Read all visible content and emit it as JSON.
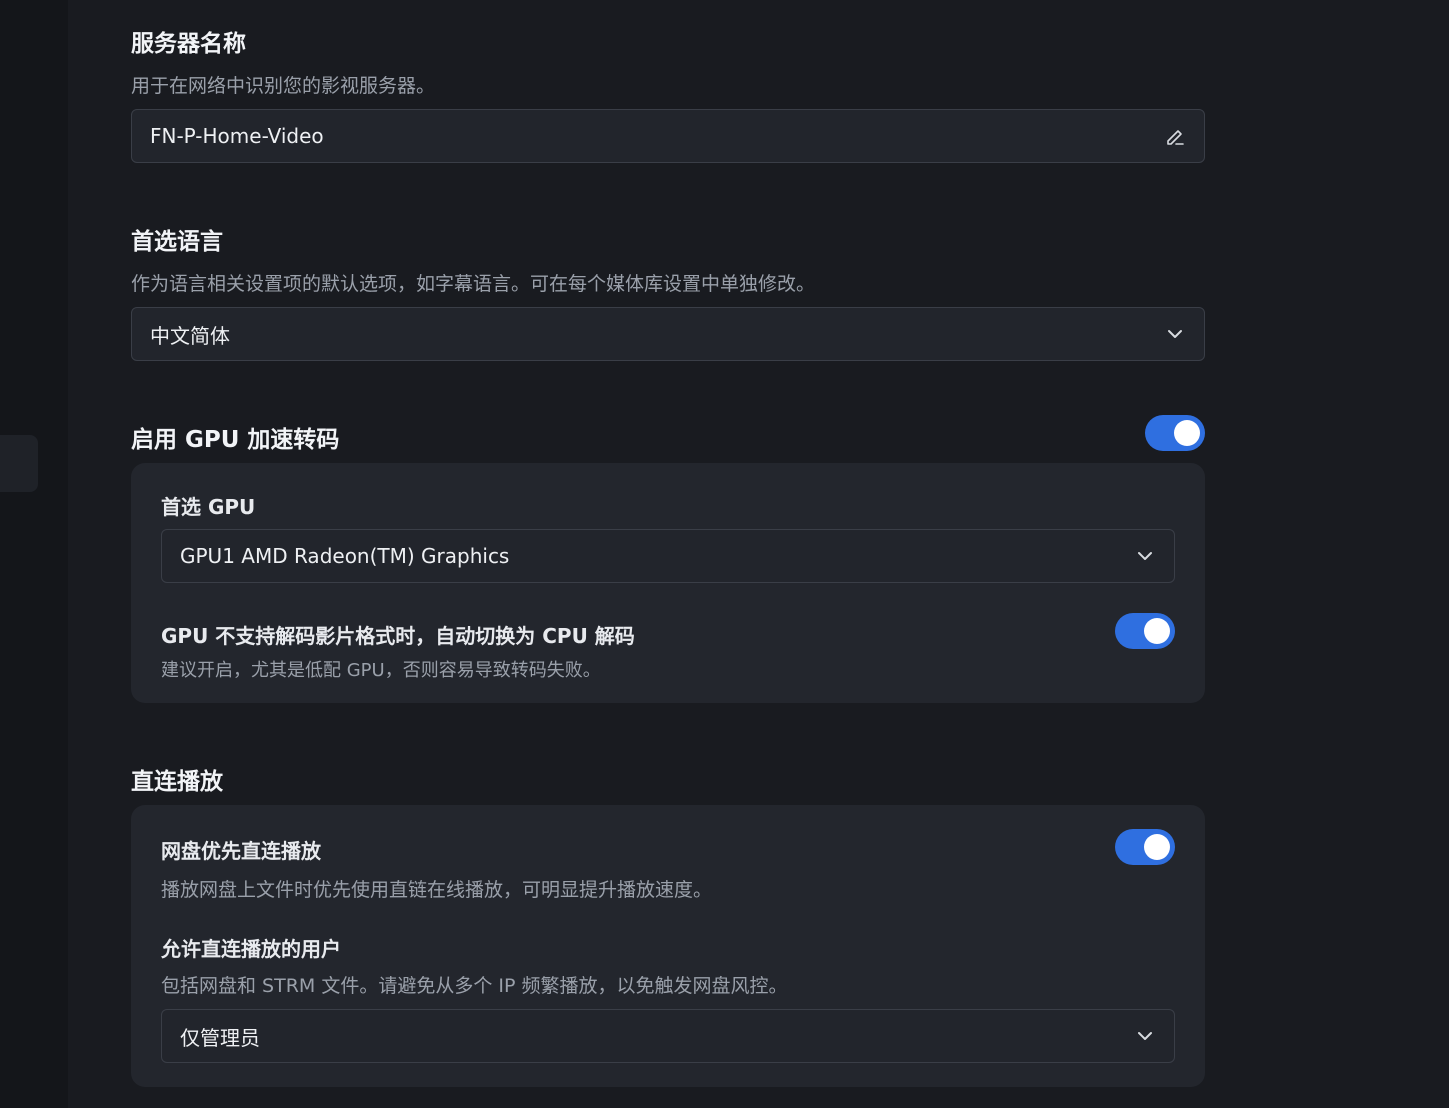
{
  "server_name": {
    "title": "服务器名称",
    "description": "用于在网络中识别您的影视服务器。",
    "value": "FN-P-Home-Video",
    "edit_icon": "pencil-icon"
  },
  "preferred_language": {
    "title": "首选语言",
    "description": "作为语言相关设置项的默认选项，如字幕语言。可在每个媒体库设置中单独修改。",
    "value": "中文简体",
    "icon": "chevron-down-icon"
  },
  "gpu_transcode": {
    "title": "启用 GPU 加速转码",
    "enabled": true,
    "preferred_gpu_label": "首选 GPU",
    "preferred_gpu_value": "GPU1 AMD Radeon(TM) Graphics",
    "fallback_title": "GPU 不支持解码影片格式时，自动切换为 CPU 解码",
    "fallback_desc": "建议开启，尤其是低配 GPU，否则容易导致转码失败。",
    "fallback_enabled": true
  },
  "direct_play": {
    "title": "直连播放",
    "netdisk_title": "网盘优先直连播放",
    "netdisk_desc": "播放网盘上文件时优先使用直链在线播放，可明显提升播放速度。",
    "netdisk_enabled": true,
    "allowed_users_title": "允许直连播放的用户",
    "allowed_users_desc": "包括网盘和 STRM 文件。请避免从多个 IP 频繁播放，以免触发网盘风控。",
    "allowed_users_value": "仅管理员"
  },
  "colors": {
    "accent": "#2f6fe0",
    "background": "#191b20",
    "card": "#23262d"
  }
}
